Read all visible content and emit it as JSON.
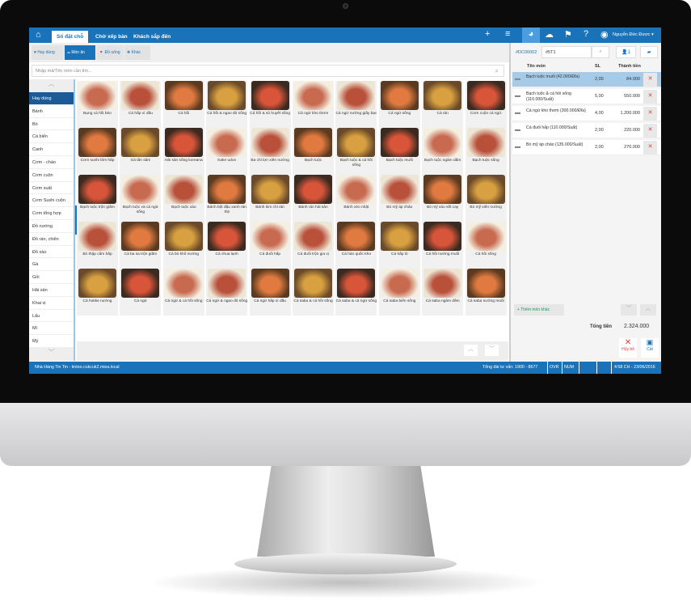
{
  "topbar": {
    "tabs": [
      "Sổ đặt chỗ",
      "Chờ xếp bàn",
      "Khách sắp đến"
    ],
    "user": "Nguyễn Đức Được ▾"
  },
  "toolbar": {
    "buttons": [
      "Hay dùng",
      "Món ăn",
      "Đồ uống",
      "Khác"
    ]
  },
  "search": {
    "placeholder": "Nhập mã/Tên món cần tìm..."
  },
  "sidebar": {
    "items": [
      "Hay dùng",
      "Bánh",
      "Bò",
      "Cá biển",
      "Canh",
      "Cơm - cháo",
      "Cơm cuộn",
      "Cơm suất",
      "Cơm Sushi cuộn",
      "Cơm tổng hợp",
      "Đồ nướng",
      "Đồ rán, chiên",
      "Đồ xào",
      "Gà",
      "Gỏi",
      "Hải sản",
      "Khai vị",
      "Lẩu",
      "Mì",
      "Mỳ"
    ]
  },
  "menu_items": [
    "Bụng cá hồi béo",
    "Cá hấp xì dầu",
    "Cá hồi",
    "Cá hồi & ngao đỏ sống",
    "Cá hồi & sò huyết sống",
    "Cá ngừ kho thơm",
    "Cá ngừ nướng giấy bạc",
    "Cá ngừ sống",
    "Cá rán",
    "Cơm cuộn cá ngừ",
    "Cơm sushi tôm hấp",
    "Gà tần sâm",
    "Hải sản sống koreana",
    "Kake udon",
    "Ba chỉ lợn xiên nướng",
    "Bạch tuộc",
    "Bạch tuộc & cá hồi sống",
    "Bạch tuộc muối",
    "Bạch tuộc ngâm dấm",
    "Bạch tuộc sống",
    "Bạch tuộc trộn giấm",
    "Bạch tuộc và cá ngừ sống",
    "Bạch tuộc xào",
    "Bánh bột đậu xanh rán thịt",
    "Bánh kim chi rán",
    "Bánh rán hải sản",
    "Bánh xèo nhật",
    "Bò mỹ áp chảo",
    "Bò mỹ xào sốt cay",
    "Bò mỹ xiên nướng",
    "Bò thập cẩm hấp",
    "Cá ba sa trộn giấm",
    "Cá bò khô nướng",
    "Cá chua lạnh",
    "Cá đuối hấp",
    "Cá đuối trộn gia vị",
    "Cá hàn quốc kho",
    "Cá hấp lò",
    "Cá hồi nướng muối",
    "Cá hồi sống",
    "Cá hokke nướng",
    "Cá ngừ",
    "Cá ngừ & cá hồi sống",
    "Cá ngừ & ngao đỏ sống",
    "Cá ngừ hấp xì dầu",
    "Cá saba & cá hồi sống",
    "Cá saba & cá ngừ sống",
    "Cá saba biển sống",
    "Cá saba ngâm dấm",
    "Cá saba nướng muối"
  ],
  "order": {
    "id": "#DC00002",
    "table": "#5T1",
    "guests": "1",
    "headers": [
      "Tên món",
      "SL",
      "Thành tiền"
    ],
    "rows": [
      {
        "name": "Bạch tuộc muối (42.000/Đĩa)",
        "qty": "2,00",
        "total": "84.000"
      },
      {
        "name": "Bạch tuộc & cá hồi sống (110.000/Suất)",
        "qty": "5,00",
        "total": "550.000"
      },
      {
        "name": "Cá ngừ kho thơm (300.000/Đĩa)",
        "qty": "4,00",
        "total": "1.200.000"
      },
      {
        "name": "Cá đuối hấp (110.000/Suất)",
        "qty": "2,00",
        "total": "220.000"
      },
      {
        "name": "Bò mỹ áp chảo (135.000/Suất)",
        "qty": "2,00",
        "total": "270.000"
      }
    ],
    "add_label": "Thêm món khác",
    "total_label": "Tổng tiền",
    "total": "2.324.000",
    "cancel": "Hủy bỏ",
    "save": "Cất"
  },
  "status": {
    "left": "Nhà Hàng Tin Tin - tinteo.cukcuk2.misa.local",
    "hotline": "Tổng đài tư vấn: 1900 - 8677",
    "ovr": "OVR",
    "num": "NUM",
    "time": "4:58 CH - 23/06/2016"
  }
}
